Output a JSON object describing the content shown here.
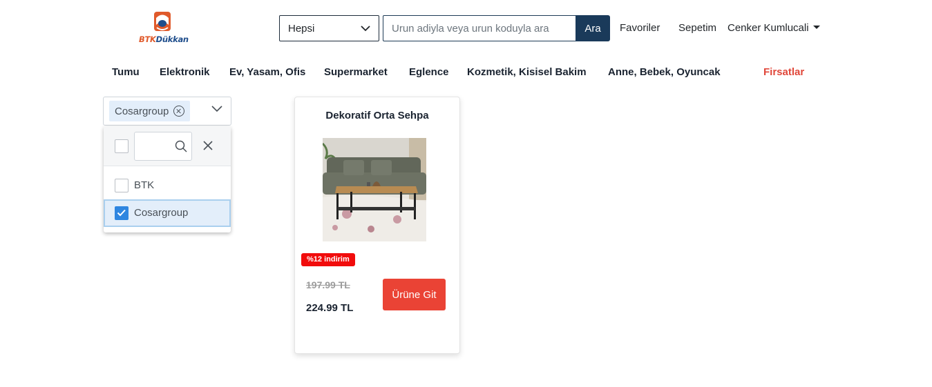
{
  "brand": {
    "logo_text_primary": "BTK",
    "logo_text_secondary": "Dükkan",
    "colors": {
      "orange": "#e05a2b",
      "blue": "#1f4e8c"
    }
  },
  "search": {
    "category_selected": "Hepsi",
    "placeholder": "Urun adiyla veya urun koduyla ara",
    "value": "",
    "button_label": "Ara"
  },
  "header": {
    "favorites_label": "Favoriler",
    "cart_label": "Sepetim",
    "user_name": "Cenker Kumlucali"
  },
  "categories": [
    {
      "label": "Tumu"
    },
    {
      "label": "Elektronik"
    },
    {
      "label": "Ev, Yasam, Ofis"
    },
    {
      "label": "Supermarket"
    },
    {
      "label": "Eglence"
    },
    {
      "label": "Kozmetik, Kisisel Bakim"
    },
    {
      "label": "Anne, Bebek, Oyuncak"
    }
  ],
  "deals_label": "Firsatlar",
  "brand_filter": {
    "selected_chip": "Cosargroup",
    "search_value": "",
    "options": [
      {
        "label": "BTK",
        "checked": false
      },
      {
        "label": "Cosargroup",
        "checked": true
      }
    ]
  },
  "products": [
    {
      "title": "Dekoratif Orta Sehpa",
      "discount_badge": "%12 indirim",
      "old_price": "197.99 TL",
      "new_price": "224.99 TL",
      "button_label": "Ürüne Git"
    }
  ],
  "colors": {
    "primary_dark": "#1a3a5a",
    "accent_red": "#ea4335",
    "badge_red": "#f10c0c",
    "deal_text": "#e0473a",
    "check_blue": "#2f86e0"
  }
}
